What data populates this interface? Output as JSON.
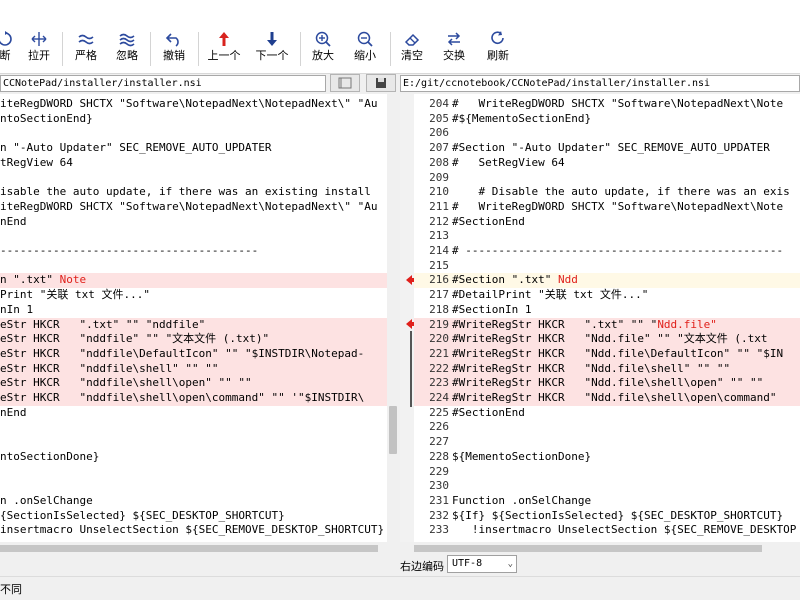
{
  "toolbar": {
    "buttons": [
      {
        "label": "断",
        "icon": "rotate-icon"
      },
      {
        "label": "拉开",
        "icon": "expand-horizontal-icon"
      },
      {
        "label": "严格",
        "icon": "approx-icon"
      },
      {
        "label": "忽略",
        "icon": "approx-wave-icon"
      },
      {
        "label": "撤销",
        "icon": "undo-icon"
      },
      {
        "label": "上一个",
        "icon": "arrow-up-icon"
      },
      {
        "label": "下一个",
        "icon": "arrow-down-icon"
      },
      {
        "label": "放大",
        "icon": "zoom-in-icon"
      },
      {
        "label": "缩小",
        "icon": "zoom-out-icon"
      },
      {
        "label": "清空",
        "icon": "eraser-icon"
      },
      {
        "label": "交换",
        "icon": "swap-icon"
      },
      {
        "label": "刷新",
        "icon": "refresh-icon"
      }
    ]
  },
  "left": {
    "path": "CCNotePad/installer/installer.nsi",
    "lines": [
      {
        "text": "iteRegDWORD SHCTX \"Software\\NotepadNext\\NotepadNext\\\" \"Au",
        "diff": false
      },
      {
        "text": "ntoSectionEnd}",
        "diff": false
      },
      {
        "text": "",
        "diff": false
      },
      {
        "text": "n \"-Auto Updater\" SEC_REMOVE_AUTO_UPDATER",
        "diff": false
      },
      {
        "text": "tRegView 64",
        "diff": false
      },
      {
        "text": "",
        "diff": false
      },
      {
        "text": "isable the auto update, if there was an existing install",
        "diff": false
      },
      {
        "text": "iteRegDWORD SHCTX \"Software\\NotepadNext\\NotepadNext\\\" \"Au",
        "diff": false
      },
      {
        "text": "nEnd",
        "diff": false
      },
      {
        "text": "",
        "diff": false
      },
      {
        "text": "---------------------------------------",
        "diff": false
      },
      {
        "text": "",
        "diff": false
      },
      {
        "text": "n \".txt\" ",
        "hl": "Note",
        "diff": true
      },
      {
        "text": "Print \"关联 txt 文件...\"",
        "diff": false
      },
      {
        "text": "nIn 1",
        "diff": false
      },
      {
        "text": "eStr HKCR   \".txt\" \"\" \"nddfile\"",
        "diff": true
      },
      {
        "text": "eStr HKCR   \"nddfile\" \"\" \"文本文件 (.txt)\"",
        "diff": true
      },
      {
        "text": "eStr HKCR   \"nddfile\\DefaultIcon\" \"\" \"$INSTDIR\\Notepad-",
        "diff": true
      },
      {
        "text": "eStr HKCR   \"nddfile\\shell\" \"\" \"\"",
        "diff": true
      },
      {
        "text": "eStr HKCR   \"nddfile\\shell\\open\" \"\" \"\"",
        "diff": true
      },
      {
        "text": "eStr HKCR   \"nddfile\\shell\\open\\command\" \"\" '\"$INSTDIR\\",
        "diff": true
      },
      {
        "text": "nEnd",
        "diff": false
      },
      {
        "text": "",
        "diff": false
      },
      {
        "text": "",
        "diff": false
      },
      {
        "text": "ntoSectionDone}",
        "diff": false
      },
      {
        "text": "",
        "diff": false
      },
      {
        "text": "",
        "diff": false
      },
      {
        "text": "n .onSelChange",
        "diff": false
      },
      {
        "text": "{SectionIsSelected} ${SEC_DESKTOP_SHORTCUT}",
        "diff": false
      },
      {
        "text": "insertmacro UnselectSection ${SEC_REMOVE_DESKTOP_SHORTCUT}",
        "diff": false
      }
    ]
  },
  "right": {
    "path": "E:/git/ccnotebook/CCNotePad/installer/installer.nsi",
    "lines": [
      {
        "num": "204",
        "text": "#   WriteRegDWORD SHCTX \"Software\\NotepadNext\\Note",
        "diff": false
      },
      {
        "num": "205",
        "text": "#${MementoSectionEnd}",
        "diff": false
      },
      {
        "num": "206",
        "text": "",
        "diff": false
      },
      {
        "num": "207",
        "text": "#Section \"-Auto Updater\" SEC_REMOVE_AUTO_UPDATER",
        "diff": false
      },
      {
        "num": "208",
        "text": "#   SetRegView 64",
        "diff": false
      },
      {
        "num": "209",
        "text": "",
        "diff": false
      },
      {
        "num": "210",
        "text": "    # Disable the auto update, if there was an exis",
        "diff": false
      },
      {
        "num": "211",
        "text": "#   WriteRegDWORD SHCTX \"Software\\NotepadNext\\Note",
        "diff": false
      },
      {
        "num": "212",
        "text": "#SectionEnd",
        "diff": false
      },
      {
        "num": "213",
        "text": "",
        "diff": false
      },
      {
        "num": "214",
        "text": "# ------------------------------------------------",
        "diff": false
      },
      {
        "num": "215",
        "text": "",
        "diff": false
      },
      {
        "num": "216",
        "text": "#Section \".txt\" ",
        "hl": "Ndd",
        "diff": false,
        "cur": true
      },
      {
        "num": "217",
        "text": "#DetailPrint \"关联 txt 文件...\"",
        "diff": false
      },
      {
        "num": "218",
        "text": "#SectionIn 1",
        "diff": false
      },
      {
        "num": "219",
        "text": "#WriteRegStr HKCR   \".txt\" \"\" \"",
        "hl": "Ndd.file\"",
        "diff": true
      },
      {
        "num": "220",
        "text": "#WriteRegStr HKCR   \"Ndd.file\" \"\" \"文本文件 (.txt",
        "diff": true
      },
      {
        "num": "221",
        "text": "#WriteRegStr HKCR   \"Ndd.file\\DefaultIcon\" \"\" \"$IN",
        "diff": true
      },
      {
        "num": "222",
        "text": "#WriteRegStr HKCR   \"Ndd.file\\shell\" \"\" \"\"",
        "diff": true
      },
      {
        "num": "223",
        "text": "#WriteRegStr HKCR   \"Ndd.file\\shell\\open\" \"\" \"\"",
        "diff": true
      },
      {
        "num": "224",
        "text": "#WriteRegStr HKCR   \"Ndd.file\\shell\\open\\command\"",
        "diff": true
      },
      {
        "num": "225",
        "text": "#SectionEnd",
        "diff": false
      },
      {
        "num": "226",
        "text": "",
        "diff": false
      },
      {
        "num": "227",
        "text": "",
        "diff": false
      },
      {
        "num": "228",
        "text": "${MementoSectionDone}",
        "diff": false
      },
      {
        "num": "229",
        "text": "",
        "diff": false
      },
      {
        "num": "230",
        "text": "",
        "diff": false
      },
      {
        "num": "231",
        "text": "Function .onSelChange",
        "diff": false
      },
      {
        "num": "232",
        "text": "${If} ${SectionIsSelected} ${SEC_DESKTOP_SHORTCUT}",
        "diff": false
      },
      {
        "num": "233",
        "text": "   !insertmacro UnselectSection ${SEC_REMOVE_DESKTOP",
        "diff": false
      }
    ]
  },
  "bottom": {
    "right_encoding_label": "右边编码",
    "right_encoding_value": "UTF-8"
  },
  "status": {
    "text": "不同"
  },
  "colors": {
    "diff_bg": "#fde2e2",
    "current_line_bg": "#fff9e6",
    "arrow_red": "#e0201b",
    "highlight_text": "#e0201b"
  }
}
